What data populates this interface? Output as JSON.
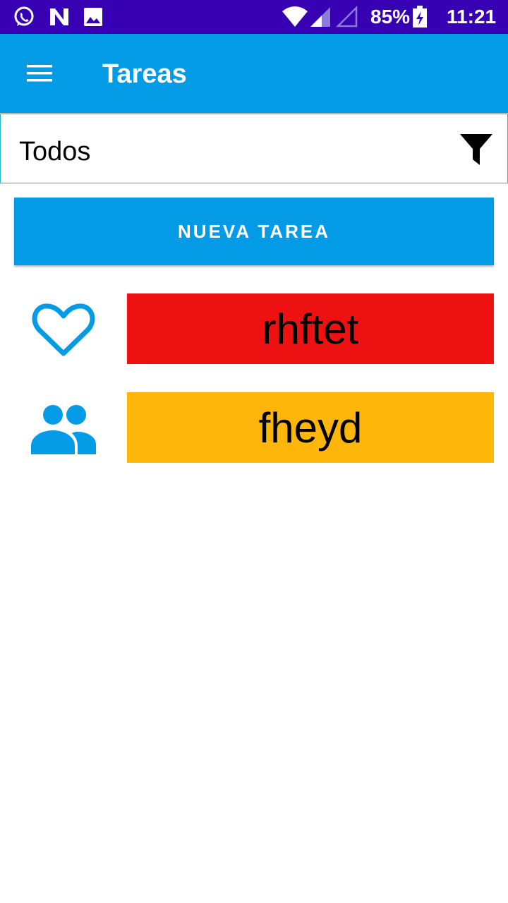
{
  "status_bar": {
    "battery": "85%",
    "time": "11:21",
    "icons": [
      "whatsapp-icon",
      "n-app-icon",
      "image-icon",
      "wifi-icon",
      "signal-icon",
      "signal-empty-icon",
      "battery-charging-icon"
    ]
  },
  "app_bar": {
    "title": "Tareas",
    "menu_icon": "hamburger-menu-icon"
  },
  "filter": {
    "selected": "Todos",
    "icon": "filter-icon"
  },
  "new_task_button": {
    "label": "NUEVA TAREA"
  },
  "tasks": [
    {
      "name": "rhftet",
      "icon": "heart-icon",
      "color": "#ee1111"
    },
    {
      "name": "fheyd",
      "icon": "group-icon",
      "color": "#ffb60b"
    }
  ],
  "colors": {
    "status_bar": "#3700b3",
    "accent": "#039be5"
  }
}
